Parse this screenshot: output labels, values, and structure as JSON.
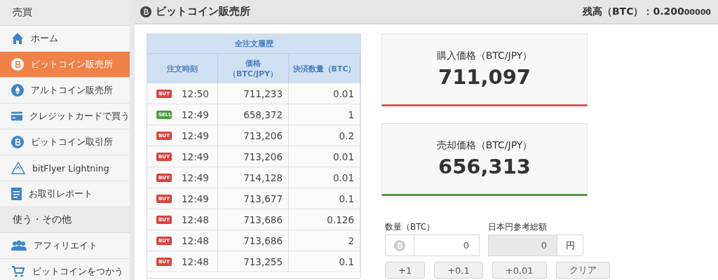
{
  "sidebar": {
    "sections": [
      {
        "title": "売買",
        "items": [
          {
            "label": "ホーム",
            "selected": false
          },
          {
            "label": "ビットコイン販売所",
            "selected": true
          },
          {
            "label": "アルトコイン販売所",
            "selected": false
          },
          {
            "label": "クレジットカードで買う",
            "selected": false
          },
          {
            "label": "ビットコイン取引所",
            "selected": false
          },
          {
            "label": "bitFlyer Lightning",
            "selected": false
          },
          {
            "label": "お取引レポート",
            "selected": false
          }
        ]
      },
      {
        "title": "使う・その他",
        "items": [
          {
            "label": "アフィリエイト",
            "selected": false
          },
          {
            "label": "ビットコインをつかう",
            "selected": false
          }
        ]
      }
    ]
  },
  "header": {
    "title": "ビットコイン販売所",
    "balance": {
      "label": "残高（BTC）：",
      "value": "0.200",
      "value_small": "00000"
    }
  },
  "orders": {
    "title": "全注文履歴",
    "columns": [
      "注文時刻",
      "価格（BTC/JPY）",
      "決済数量（BTC）"
    ],
    "rows": [
      {
        "kind": "buy",
        "badge": "BUY",
        "time": "12:50",
        "price": "711,233",
        "amount": "0.01"
      },
      {
        "kind": "sell",
        "badge": "SELL",
        "time": "12:49",
        "price": "658,372",
        "amount": "1"
      },
      {
        "kind": "buy",
        "badge": "BUY",
        "time": "12:49",
        "price": "713,206",
        "amount": "0.2"
      },
      {
        "kind": "buy",
        "badge": "BUY",
        "time": "12:49",
        "price": "713,206",
        "amount": "0.01"
      },
      {
        "kind": "buy",
        "badge": "BUY",
        "time": "12:49",
        "price": "714,128",
        "amount": "0.01"
      },
      {
        "kind": "buy",
        "badge": "BUY",
        "time": "12:49",
        "price": "713,677",
        "amount": "0.1"
      },
      {
        "kind": "buy",
        "badge": "BUY",
        "time": "12:48",
        "price": "713,686",
        "amount": "0.126"
      },
      {
        "kind": "buy",
        "badge": "BUY",
        "time": "12:48",
        "price": "713,686",
        "amount": "2"
      },
      {
        "kind": "buy",
        "badge": "BUY",
        "time": "12:48",
        "price": "713,255",
        "amount": "0.1"
      }
    ]
  },
  "prices": [
    {
      "kind": "buy",
      "label": "購入価格（BTC/JPY）",
      "value": "711,097"
    },
    {
      "kind": "sell",
      "label": "売却価格（BTC/JPY）",
      "value": "656,313"
    }
  ],
  "form": {
    "quantity": {
      "label": "数量（BTC）",
      "value": "0"
    },
    "total": {
      "label": "日本円参考総額",
      "value": "0",
      "unit": "円"
    },
    "buttons": [
      "+1",
      "+0.1",
      "+0.01",
      "クリア"
    ]
  }
}
